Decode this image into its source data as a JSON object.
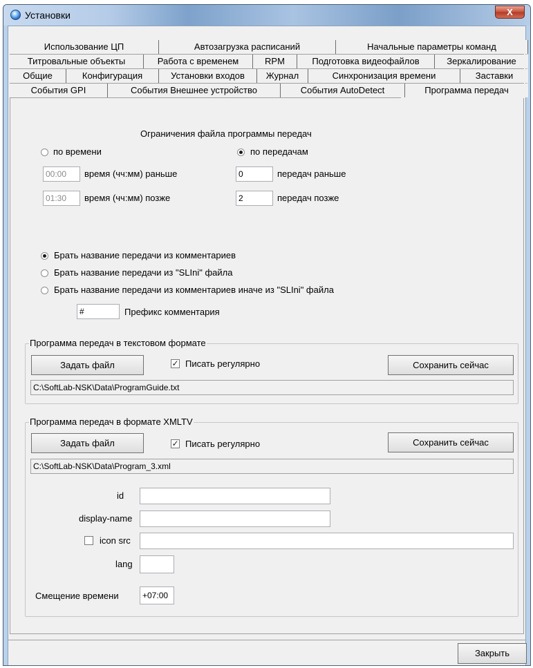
{
  "window": {
    "title": "Установки",
    "close_glyph": "X"
  },
  "tabs": {
    "row1": [
      "Использование ЦП",
      "Автозагрузка расписаний",
      "Начальные параметры команд"
    ],
    "row2": [
      "Титровальные объекты",
      "Работа с временем",
      "RPM",
      "Подготовка видеофайлов",
      "Зеркалирование"
    ],
    "row3": [
      "Общие",
      "Конфигурация",
      "Установки входов",
      "Журнал",
      "Синхронизация времени",
      "Заставки"
    ],
    "row4": [
      "События GPI",
      "События Внешнее устройство",
      "События AutoDetect",
      "Программа передач"
    ],
    "active": "Программа передач"
  },
  "limits": {
    "heading": "Ограничения файла программы передач",
    "by_time_label": "по времени",
    "by_time_selected": false,
    "by_programs_label": "по передачам",
    "by_programs_selected": true,
    "time_before_value": "00:00",
    "time_before_label": "время (чч:мм) раньше",
    "time_after_value": "01:30",
    "time_after_label": "время (чч:мм) позже",
    "programs_before_value": "0",
    "programs_before_label": "передач раньше",
    "programs_after_value": "2",
    "programs_after_label": "передач позже"
  },
  "name_source": {
    "options": [
      {
        "label": "Брать название передачи из комментариев",
        "selected": true
      },
      {
        "label": "Брать название передачи из \"SLIni\" файла",
        "selected": false
      },
      {
        "label": "Брать название передачи из комментариев иначе из \"SLIni\" файла",
        "selected": false
      }
    ],
    "prefix_value": "#",
    "prefix_label": "Префикс комментария"
  },
  "text_group": {
    "title": "Программа передач в текстовом формате",
    "set_file_label": "Задать файл",
    "write_regularly_label": "Писать регулярно",
    "write_regularly_checked": true,
    "save_now_label": "Сохранить сейчас",
    "path": "C:\\SoftLab-NSK\\Data\\ProgramGuide.txt"
  },
  "xmltv_group": {
    "title": "Программа передач в формате XMLTV",
    "set_file_label": "Задать файл",
    "write_regularly_label": "Писать регулярно",
    "write_regularly_checked": true,
    "save_now_label": "Сохранить сейчас",
    "path": "C:\\SoftLab-NSK\\Data\\Program_3.xml",
    "id_label": "id",
    "id_value": "",
    "display_name_label": "display-name",
    "display_name_value": "",
    "icon_src_label": "icon src",
    "icon_src_checked": false,
    "icon_src_value": "",
    "lang_label": "lang",
    "lang_value": "",
    "time_offset_label": "Смещение времени",
    "time_offset_value": "+07:00"
  },
  "footer": {
    "close_label": "Закрыть"
  }
}
